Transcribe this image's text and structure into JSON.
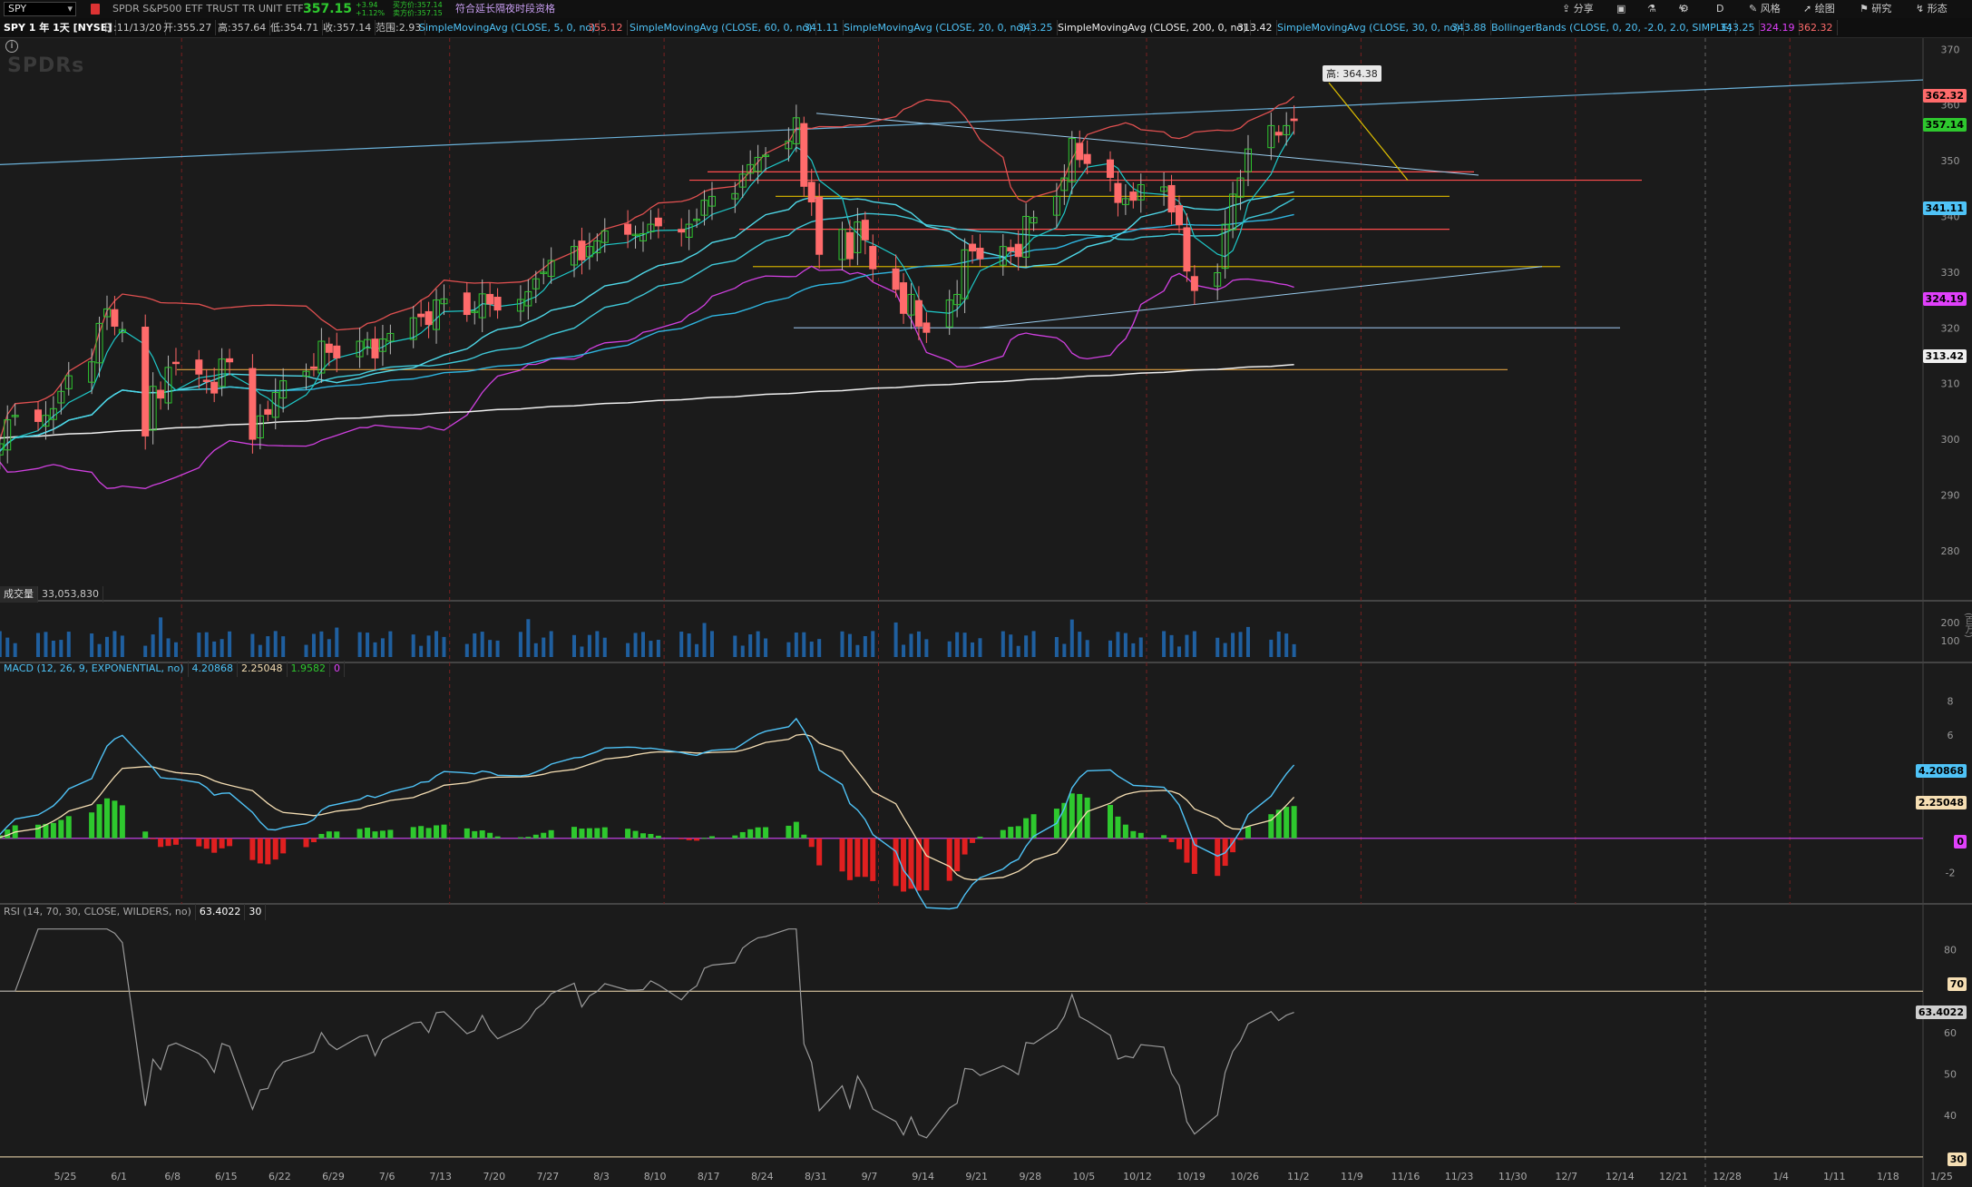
{
  "header": {
    "symbol": "SPY",
    "company": "SPDR S&P500 ETF TRUST TR UNIT ETF",
    "price": "357.15",
    "change": "+3.94",
    "change_pct": "+1.12%",
    "bid": "买方价:357.14",
    "ask": "卖方价:357.15",
    "extended_hours": "符合延长隔夜时段资格",
    "toolbar": {
      "share": "分享",
      "style": "风格",
      "draw": "绘图",
      "study": "研究",
      "pattern": "形态",
      "period": "D"
    },
    "colors": {
      "up": "#2ec82e",
      "down": "#ff4d4d",
      "accent": "#5fc8ff"
    }
  },
  "studybar": {
    "period": "SPY 1 年 1天 [NYSE]",
    "date": "日:11/13/20",
    "open": "开:355.27",
    "high": "高:357.64",
    "low": "低:354.71",
    "close": "收:357.14",
    "range": "范围:2.93",
    "studies": [
      {
        "label": "SimpleMovingAvg (CLOSE, 5, 0, no)",
        "value": "355.12",
        "color": "#ff6b6b"
      },
      {
        "label": "SimpleMovingAvg (CLOSE, 60, 0, no)",
        "value": "341.11",
        "color": "#4fc3f7"
      },
      {
        "label": "SimpleMovingAvg (CLOSE, 20, 0, no)",
        "value": "343.25",
        "color": "#4fc3f7"
      },
      {
        "label": "SimpleMovingAvg (CLOSE, 200, 0, no)",
        "value": "313.42",
        "color": "#f0f0f0"
      },
      {
        "label": "SimpleMovingAvg (CLOSE, 30, 0, no)",
        "value": "343.88",
        "color": "#4fc3f7"
      },
      {
        "label": "BollingerBands (CLOSE, 0, 20, -2.0, 2.0, SIMPLE)",
        "value": "343.25",
        "value2": "324.19",
        "value3": "362.32",
        "color": "#4fc3f7"
      }
    ]
  },
  "price_badges": {
    "bb_upper": {
      "text": "362.32",
      "value": 362.32,
      "color": "#ff6b6b"
    },
    "last": {
      "text": "357.14",
      "value": 357.14,
      "color": "#2ec82e"
    },
    "sma60": {
      "text": "341.11",
      "value": 341.11,
      "color": "#4fc3f7"
    },
    "sma200": {
      "text": "313.42",
      "value": 313.42,
      "color": "#f0f0f0"
    },
    "bb_lower": {
      "text": "324.19",
      "value": 324.19,
      "color": "#e040fb"
    }
  },
  "high_label": {
    "text": "高: 364.38",
    "value": 364.38
  },
  "watermark": "SPDRs",
  "volume_panel": {
    "label": "成交量",
    "value": "33,053,830",
    "unit": "(百万)",
    "ticks": [
      "200",
      "100"
    ]
  },
  "macd_panel": {
    "label": "MACD (12, 26, 9, EXPONENTIAL, no)",
    "v1": "4.20868",
    "v2": "2.25048",
    "v3": "1.9582",
    "v4": "0",
    "badge_value": "4.20868",
    "badge_avg": "2.25048",
    "badge_zero": "0"
  },
  "rsi_panel": {
    "label": "RSI (14, 70, 30, CLOSE, WILDERS, no)",
    "v1": "63.4022",
    "v2": "30",
    "v3": "70",
    "badge_value": "63.4022",
    "badge_70": "70",
    "badge_30": "30"
  },
  "chart_data": {
    "type": "candlestick",
    "x_labels": [
      "5/25",
      "6/1",
      "6/8",
      "6/15",
      "6/22",
      "6/29",
      "7/6",
      "7/13",
      "7/20",
      "7/27",
      "8/3",
      "8/10",
      "8/17",
      "8/24",
      "8/31",
      "9/7",
      "9/14",
      "9/21",
      "9/28",
      "10/5",
      "10/12",
      "10/19",
      "10/26",
      "11/2",
      "11/9",
      "11/16",
      "11/23",
      "11/30",
      "12/7",
      "12/14",
      "12/21",
      "12/28",
      "1/4",
      "1/11",
      "1/18",
      "1/25"
    ],
    "x_week_starts_days": [
      0,
      7,
      14,
      21,
      28,
      35,
      42,
      49,
      56,
      63,
      70,
      77,
      84,
      91,
      98,
      105,
      112,
      119,
      126,
      133,
      140,
      147,
      154,
      161,
      168,
      175,
      182,
      189,
      196,
      203,
      210,
      217,
      224,
      231,
      238,
      245
    ],
    "price_axis": {
      "ylim": [
        272,
        372
      ],
      "ticks": [
        280,
        290,
        300,
        310,
        320,
        330,
        340,
        350,
        360,
        370
      ]
    },
    "macd_axis": {
      "ylim": [
        -3.5,
        9.5
      ],
      "ticks": [
        -2,
        2,
        4,
        6,
        8
      ]
    },
    "rsi_axis": {
      "ylim": [
        28,
        88
      ],
      "ticks": [
        40,
        50,
        60,
        80
      ]
    },
    "closes": [
      296.9,
      297.5,
      299.2,
      303.5,
      304.3,
      303.2,
      304.3,
      305.5,
      308.6,
      311.4,
      313.9,
      320.8,
      323.4,
      320.3,
      319.7,
      300.6,
      309.5,
      307.4,
      312.9,
      313.6,
      311.7,
      310.6,
      308.3,
      314.4,
      313.9,
      300.0,
      304.2,
      304.5,
      308.4,
      310.5,
      312.2,
      312.9,
      317.6,
      315.6,
      314.6,
      317.6,
      317.9,
      314.6,
      318.0,
      319.0,
      321.8,
      322.0,
      320.6,
      325.0,
      325.2,
      322.4,
      323.0,
      326.1,
      324.3,
      323.2,
      325.1,
      326.5,
      328.8,
      330.0,
      332.1,
      334.6,
      332.2,
      334.6,
      335.6,
      337.4,
      336.8,
      336.8,
      336.9,
      338.6,
      338.3,
      337.2,
      338.6,
      339.5,
      342.9,
      343.6,
      344.1,
      347.6,
      349.3,
      350.6,
      351.0,
      353.5,
      357.7,
      345.4,
      342.6,
      333.2,
      337.7,
      332.4,
      339.0,
      335.8,
      330.6,
      326.9,
      322.6,
      326.0,
      320.3,
      319.2,
      325.0,
      326.0,
      334.0,
      333.8,
      332.4,
      334.6,
      333.8,
      332.8,
      340.0,
      339.8,
      343.6,
      346.9,
      354.0,
      350.2,
      349.5,
      347.0,
      342.5,
      343.2,
      342.9,
      345.7,
      345.3,
      340.8,
      338.5,
      330.2,
      326.7,
      329.9,
      338.6,
      344.0,
      346.9,
      352.1,
      356.3,
      354.6,
      356.3,
      357.2
    ],
    "day_offsets_note_hidden": "",
    "sma_values": {
      "sma5": 355.12,
      "sma20": 343.25,
      "sma30": 343.88,
      "sma60": 341.11,
      "sma200": 313.42
    },
    "bollinger": {
      "upper": 362.32,
      "middle": 343.25,
      "lower": 324.19
    },
    "support_resistance": [
      {
        "value": 346.5,
        "color": "#ff4d4d"
      },
      {
        "value": 337.7,
        "color": "#ff4d4d"
      },
      {
        "value": 348.0,
        "color": "#ff4d4d"
      },
      {
        "value": 343.6,
        "color": "#c8a800"
      },
      {
        "value": 331.0,
        "color": "#c8a800"
      },
      {
        "value": 320.0,
        "color": "#88aacc"
      },
      {
        "value": 312.5,
        "color": "#e0a040"
      }
    ]
  }
}
